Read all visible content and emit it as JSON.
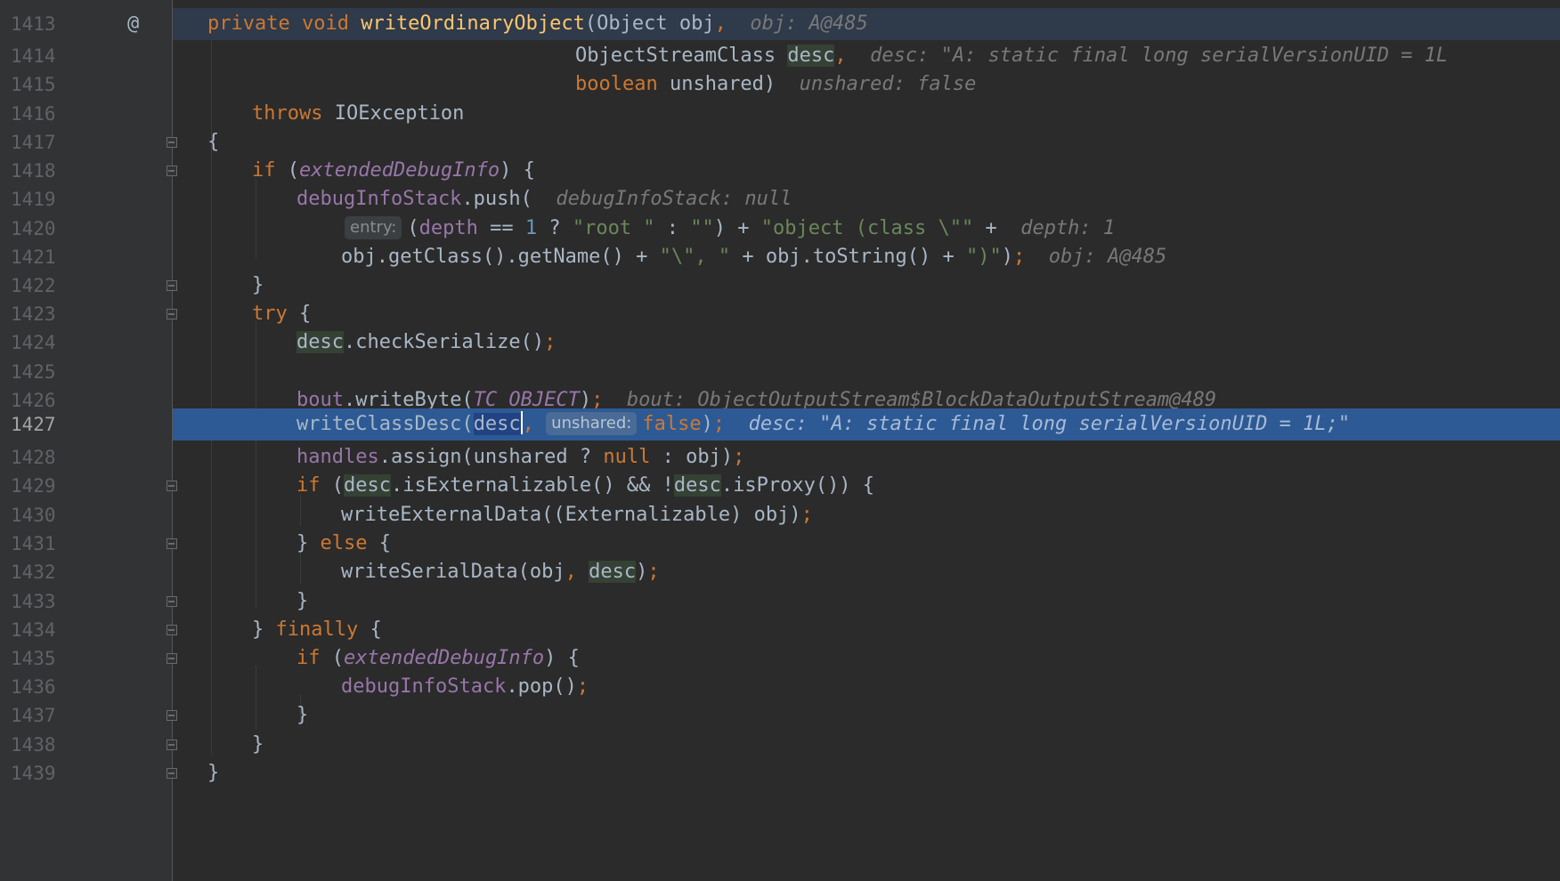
{
  "editor": {
    "theme": "Darcula",
    "current_line": "1427",
    "colors": {
      "background": "#2b2b2b",
      "gutter": "#313335",
      "execution_line": "#2d5a94",
      "keyword": "#cc7832",
      "method": "#ffc66d",
      "field": "#9876aa",
      "string": "#6a8759",
      "number": "#6897bb",
      "hint": "#787878"
    },
    "gutter_annotation": "@"
  },
  "lines": [
    {
      "number": "1413",
      "kw1": "private",
      "kw2": "void",
      "fn": "writeOrdinaryObject",
      "p1": "(Object obj",
      "comma": ",",
      "hint": "obj: A@485"
    },
    {
      "number": "1414",
      "type": "ObjectStreamClass ",
      "var": "desc",
      "comma": ",",
      "hint": "desc: \"A: static final long serialVersionUID = 1L"
    },
    {
      "number": "1415",
      "kw": "boolean",
      "rest": " unshared)",
      "hint": "unshared: false"
    },
    {
      "number": "1416",
      "kw": "throws",
      "rest": " IOException"
    },
    {
      "number": "1417",
      "text": "{"
    },
    {
      "number": "1418",
      "kw": "if",
      "open": " (",
      "field": "extendedDebugInfo",
      "close": ") {"
    },
    {
      "number": "1419",
      "field": "debugInfoStack",
      "rest": ".push(",
      "hint": "debugInfoStack: null"
    },
    {
      "number": "1420",
      "tag": "entry:",
      "p1": "(",
      "field": "depth",
      "p2": " == ",
      "num": "1",
      "p3": " ? ",
      "s1": "\"root \"",
      "p4": " : ",
      "s2": "\"\"",
      "p5": ") + ",
      "s3": "\"object (class \\\"\"",
      "p6": " +",
      "hint": "depth: 1"
    },
    {
      "number": "1421",
      "p1": "obj.getClass().getName() + ",
      "s1": "\"\\\", \"",
      "p2": " + obj.toString() + ",
      "s2": "\")\"",
      "p3": ")",
      "semi": ";",
      "hint": "obj: A@485"
    },
    {
      "number": "1422",
      "text": "}"
    },
    {
      "number": "1423",
      "kw": "try",
      "rest": " {"
    },
    {
      "number": "1424",
      "var": "desc",
      "rest": ".checkSerialize()",
      "semi": ";"
    },
    {
      "number": "1425",
      "text": ""
    },
    {
      "number": "1426",
      "field": "bout",
      "p1": ".writeByte(",
      "sfield": "TC_OBJECT",
      "p2": ")",
      "semi": ";",
      "hint": "bout: ObjectOutputStream$BlockDataOutputStream@489"
    },
    {
      "number": "1427",
      "p1": "writeClassDesc(",
      "var": "desc",
      "comma": ",",
      "tag": "unshared:",
      "kw": "false",
      "p2": ")",
      "semi": ";",
      "hint": "desc: \"A: static final long serialVersionUID = 1L;\""
    },
    {
      "number": "1428",
      "field": "handles",
      "p1": ".assign(unshared ? ",
      "kw": "null",
      "p2": " : obj)",
      "semi": ";"
    },
    {
      "number": "1429",
      "kw": "if",
      "p1": " (",
      "var1": "desc",
      "p2": ".isExternalizable() && !",
      "var2": "desc",
      "p3": ".isProxy()) {"
    },
    {
      "number": "1430",
      "p1": "writeExternalData((Externalizable) obj)",
      "semi": ";"
    },
    {
      "number": "1431",
      "p1": "} ",
      "kw": "else",
      "p2": " {"
    },
    {
      "number": "1432",
      "p1": "writeSerialData(obj",
      "comma": ",",
      "p2": " ",
      "var": "desc",
      "p3": ")",
      "semi": ";"
    },
    {
      "number": "1433",
      "text": "}"
    },
    {
      "number": "1434",
      "p1": "} ",
      "kw": "finally",
      "p2": " {"
    },
    {
      "number": "1435",
      "kw": "if",
      "open": " (",
      "field": "extendedDebugInfo",
      "close": ") {"
    },
    {
      "number": "1436",
      "field": "debugInfoStack",
      "rest": ".pop()",
      "semi": ";"
    },
    {
      "number": "1437",
      "text": "}"
    },
    {
      "number": "1438",
      "text": "}"
    },
    {
      "number": "1439",
      "text": "}"
    }
  ]
}
